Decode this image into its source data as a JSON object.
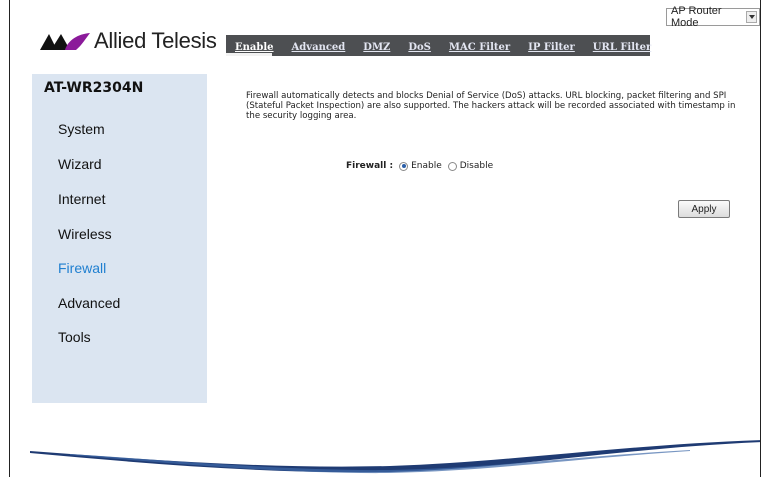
{
  "mode_select": {
    "value": "AP Router Mode"
  },
  "logo": {
    "text": "Allied Telesis"
  },
  "tabs": [
    {
      "label": "Enable",
      "active": true
    },
    {
      "label": "Advanced"
    },
    {
      "label": "DMZ"
    },
    {
      "label": "DoS"
    },
    {
      "label": "MAC Filter"
    },
    {
      "label": "IP Filter"
    },
    {
      "label": "URL Filter"
    }
  ],
  "sidebar": {
    "product": "AT-WR2304N",
    "items": [
      {
        "label": "System"
      },
      {
        "label": "Wizard"
      },
      {
        "label": "Internet"
      },
      {
        "label": "Wireless"
      },
      {
        "label": "Firewall",
        "active": true
      },
      {
        "label": "Advanced"
      },
      {
        "label": "Tools"
      }
    ]
  },
  "content": {
    "description": "Firewall automatically detects and blocks Denial of Service (DoS) attacks. URL blocking, packet filtering and SPI (Stateful Packet Inspection) are also supported. The hackers attack will be recorded associated with timestamp in the security logging area.",
    "firewall_label": "Firewall :",
    "enable_label": "Enable",
    "disable_label": "Disable",
    "firewall_value": "Enable",
    "apply_label": "Apply"
  },
  "colors": {
    "tab_bar": "#4d4f52",
    "sidebar_bg": "#dbe5f1",
    "active_nav": "#1f7fd0",
    "swoosh": "#1f3b73"
  }
}
